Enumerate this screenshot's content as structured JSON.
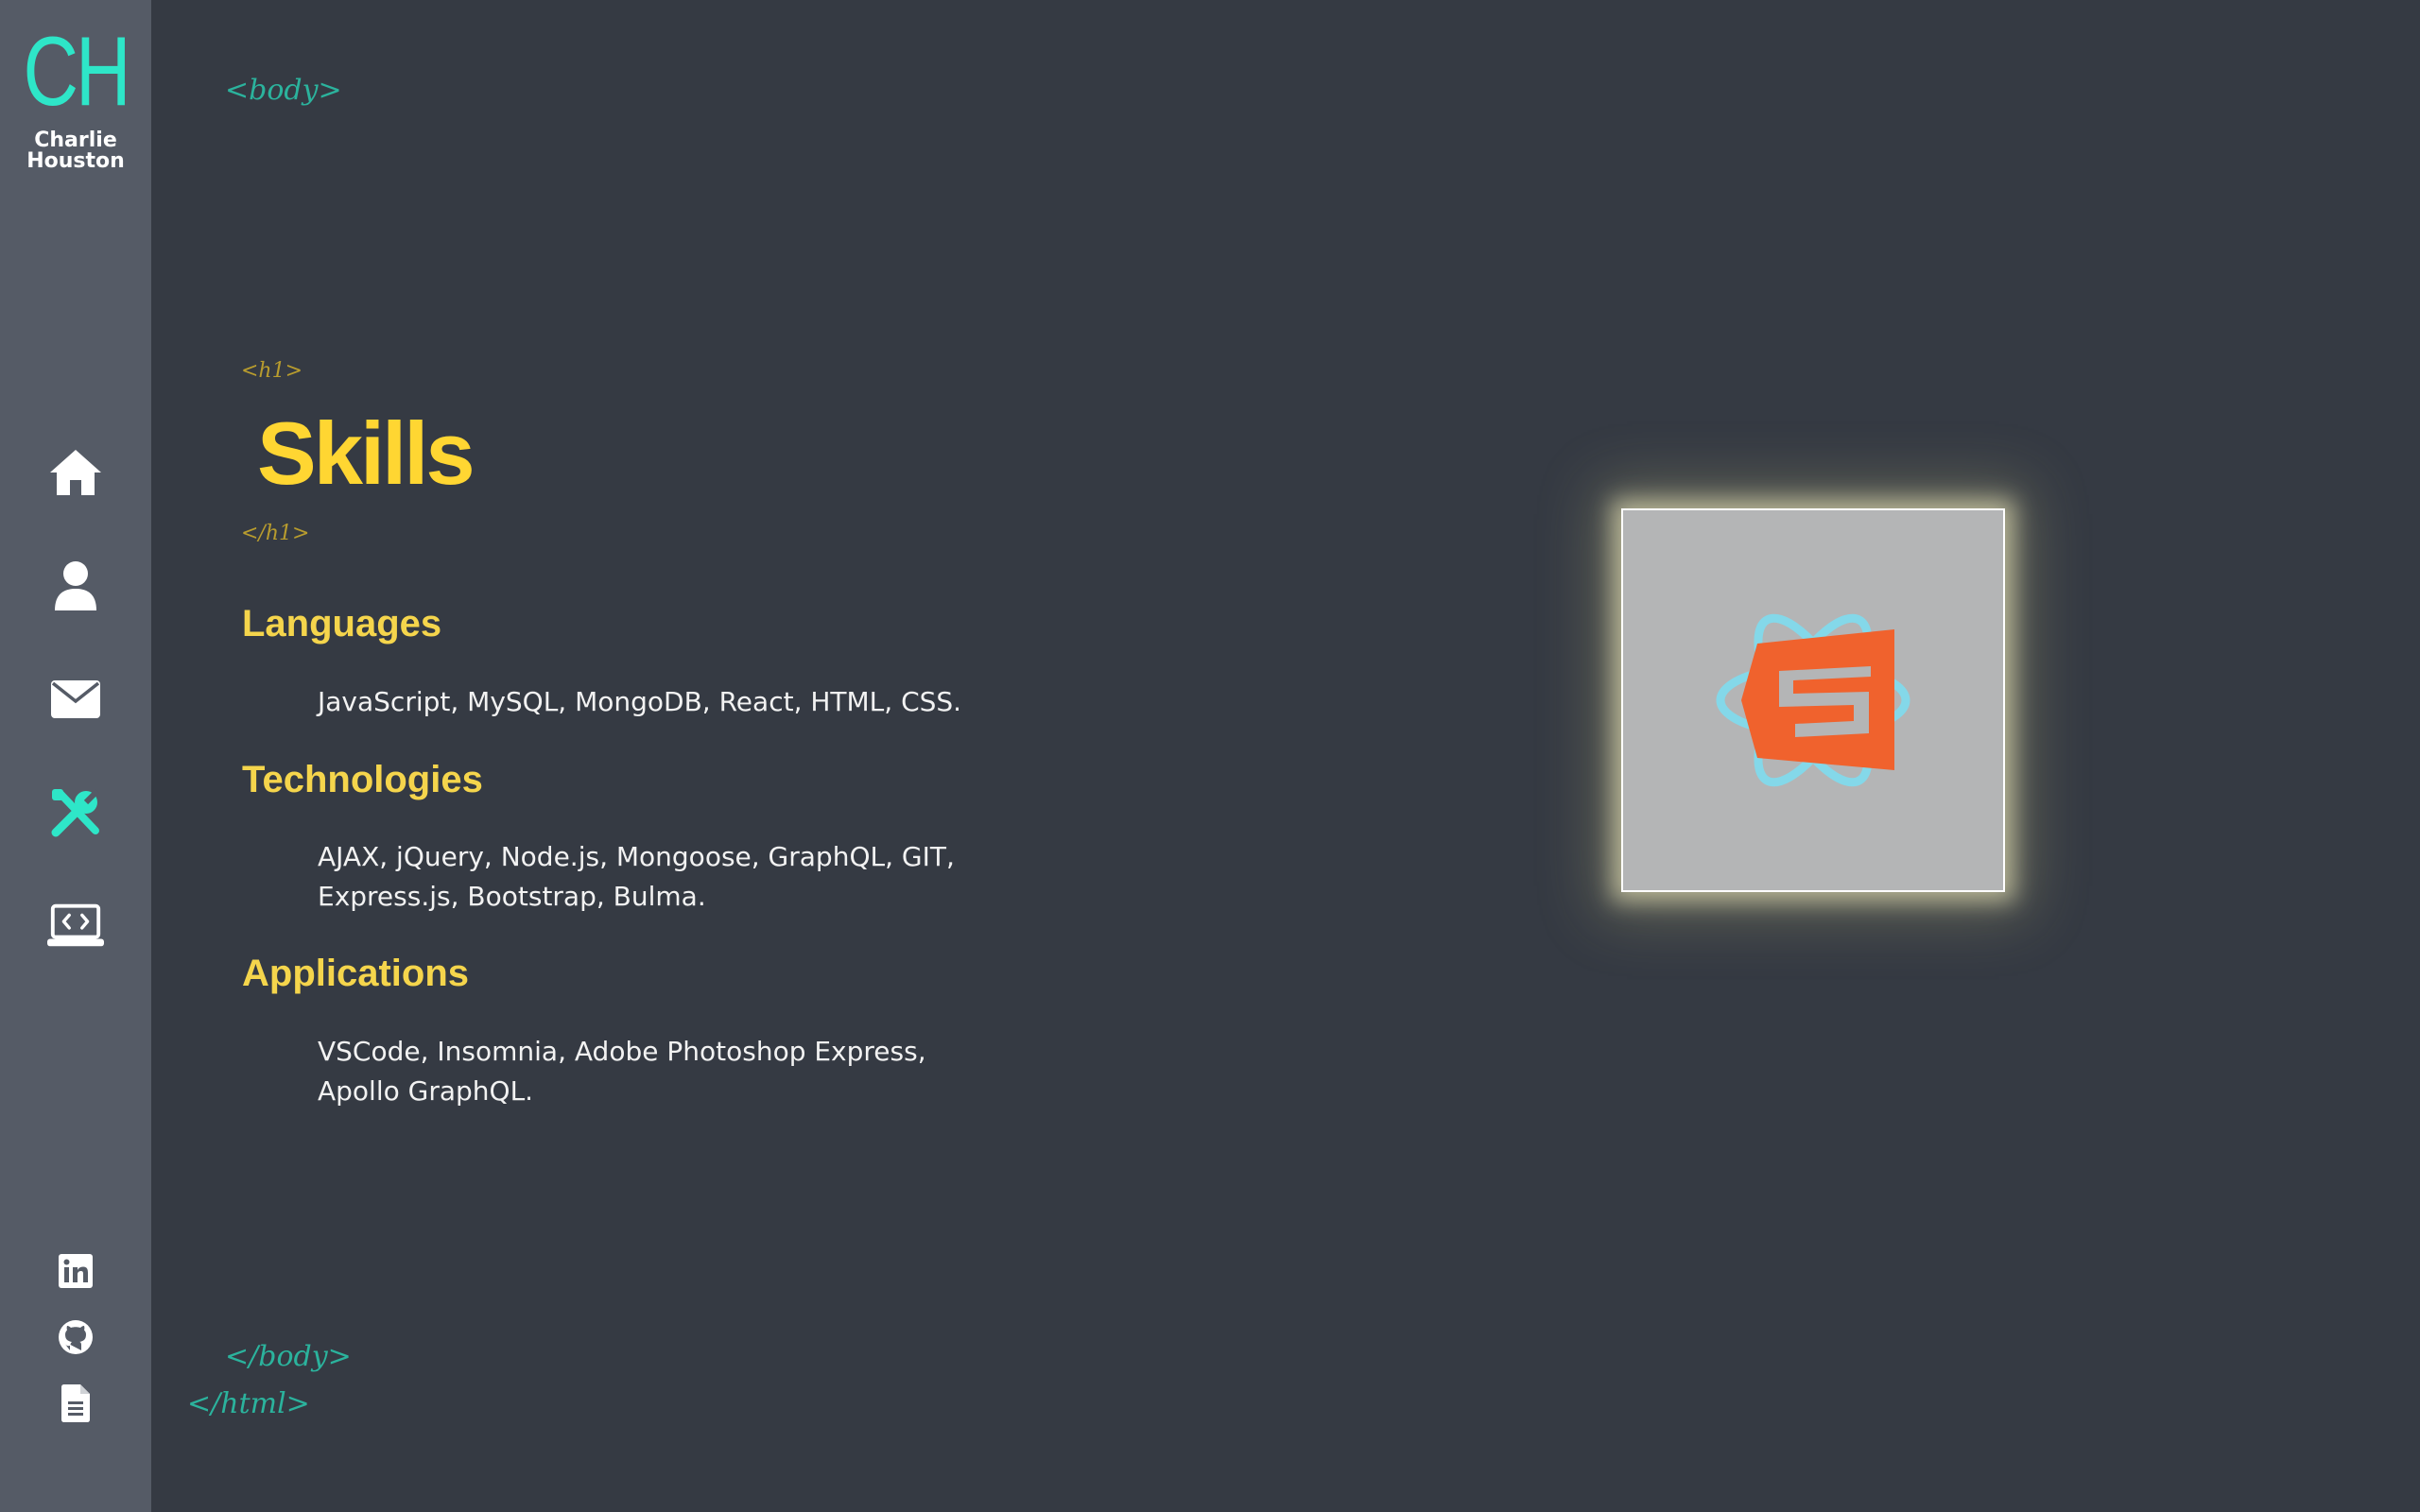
{
  "brand": {
    "mark": "CH",
    "name": "Charlie Houston",
    "accent": "#2ee6c8"
  },
  "sidebar": {
    "nav": [
      {
        "icon": "home-icon",
        "label": "Home"
      },
      {
        "icon": "user-icon",
        "label": "About"
      },
      {
        "icon": "envelope-icon",
        "label": "Contact"
      },
      {
        "icon": "tools-icon",
        "label": "Skills",
        "active": true
      },
      {
        "icon": "laptop-code-icon",
        "label": "Portfolio"
      }
    ],
    "social": [
      {
        "icon": "linkedin-icon"
      },
      {
        "icon": "github-icon"
      },
      {
        "icon": "document-icon"
      }
    ]
  },
  "tags": {
    "body_open": "<body>",
    "h1_open": "<h1>",
    "h1_close": "</h1>",
    "body_close": "</body>",
    "html_close": "</html>"
  },
  "page": {
    "title": "Skills",
    "title_color": "#ffd632"
  },
  "sections": [
    {
      "heading": "Languages",
      "text": "JavaScript, MySQL, MongoDB, React, HTML, CSS."
    },
    {
      "heading": "Technologies",
      "text": "AJAX, jQuery, Node.js, Mongoose, GraphQL, GIT, Express.js, Bootstrap, Bulma."
    },
    {
      "heading": "Applications",
      "text": "VSCode, Insomnia, Adobe Photoshop Express, Apollo GraphQL."
    }
  ],
  "illustration": {
    "icons": [
      "html5-icon",
      "react-icon"
    ],
    "html5_color": "#f0622d",
    "react_color": "#7fdcef"
  }
}
